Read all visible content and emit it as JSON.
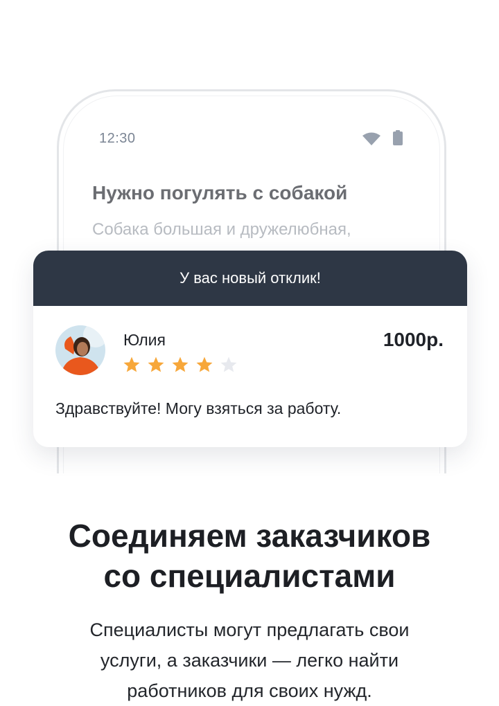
{
  "phone": {
    "status_time": "12:30",
    "status_icons": [
      "wifi-icon",
      "battery-icon"
    ],
    "task_title": "Нужно погулять с собакой",
    "task_description": "Собака большая и дружелюбная,"
  },
  "notification": {
    "header": "У вас новый отклик!",
    "user_name": "Юлия",
    "rating": 4,
    "rating_max": 5,
    "price": "1000р.",
    "message": "Здравствуйте! Могу взяться за работу."
  },
  "intro": {
    "headline_line1": "Соединяем заказчиков",
    "headline_line2": "со специалистами",
    "description_line1": "Специалисты могут предлагать свои",
    "description_line2": "услуги, а заказчики — легко найти",
    "description_line3": "работников для своих нужд."
  },
  "colors": {
    "card_header_bg": "#2e3745",
    "star_filled": "#f7a73a",
    "star_empty": "#e7e9ee"
  }
}
